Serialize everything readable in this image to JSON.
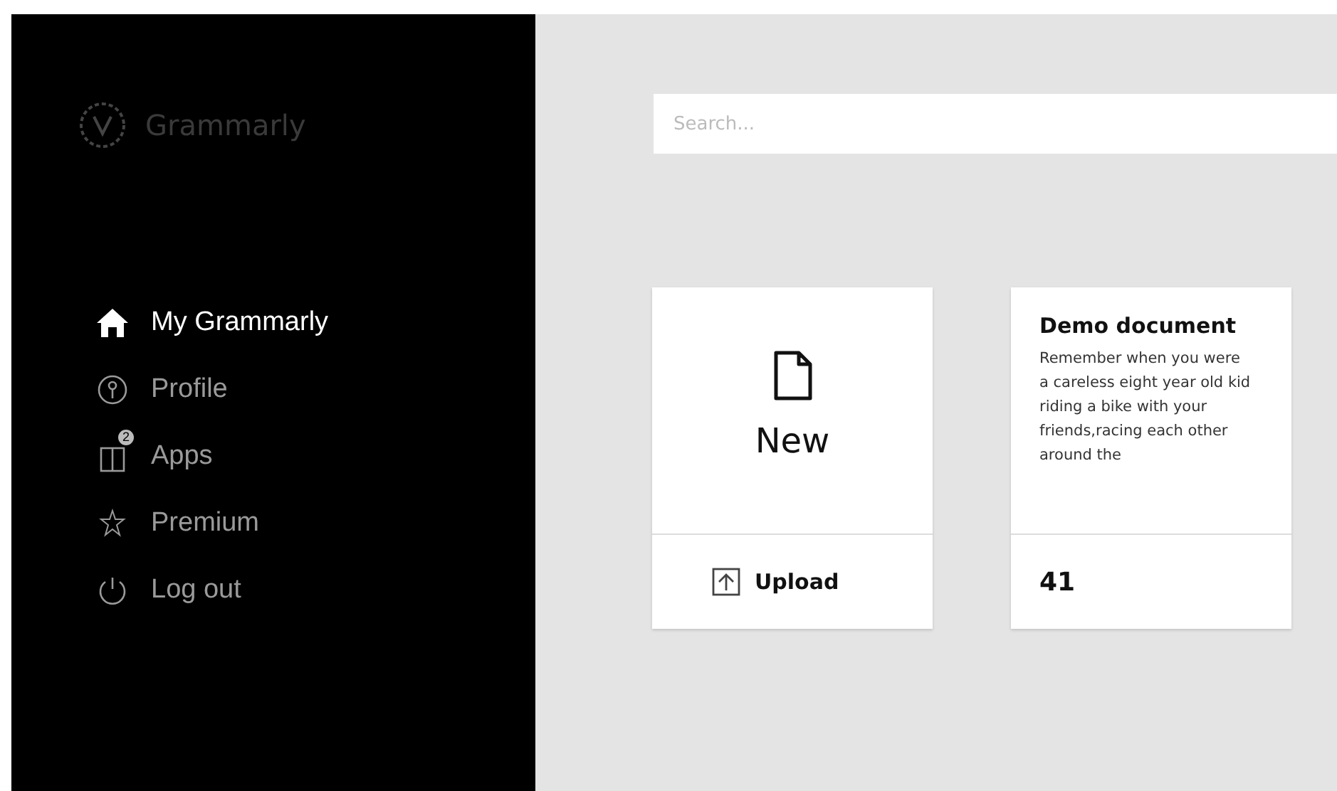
{
  "sidebar": {
    "logo": {
      "text": "Grammarly"
    },
    "items": [
      {
        "label": "My Grammarly",
        "kind": "home",
        "selected": true
      },
      {
        "label": "Profile",
        "kind": "profile",
        "selected": false
      },
      {
        "label": "Apps",
        "kind": "apps",
        "badge": "2",
        "selected": false
      },
      {
        "label": "Premium",
        "kind": "premium",
        "selected": false
      },
      {
        "label": "Log out",
        "kind": "logout",
        "selected": false
      }
    ]
  },
  "search": {
    "placeholder": "Search..."
  },
  "cards": [
    {
      "kind": "new",
      "label": "New",
      "action": "Upload"
    },
    {
      "kind": "document",
      "title": "Demo document",
      "excerpt": "Remember when you were a careless eight year old kid riding a bike with your friends,racing each other around the",
      "count": "41"
    }
  ]
}
